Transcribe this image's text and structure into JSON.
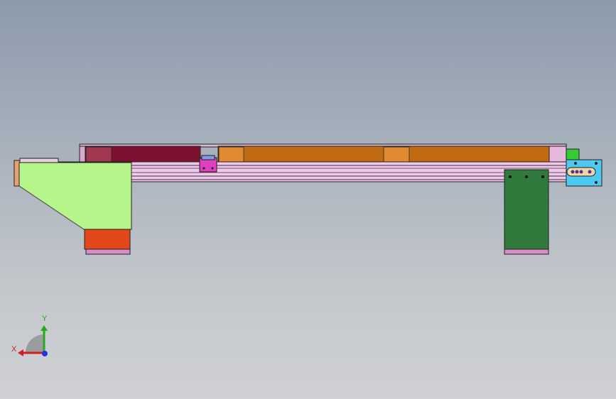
{
  "viewport": {
    "background_top": "#8c9aac",
    "background_bottom": "#cfd1d4"
  },
  "model": {
    "parts": [
      {
        "name": "rail-beam",
        "color": "#f2c8ec"
      },
      {
        "name": "left-hopper",
        "color": "#b5f58c"
      },
      {
        "name": "left-base",
        "color": "#e2481a"
      },
      {
        "name": "right-support",
        "color": "#2f7a3a"
      },
      {
        "name": "dark-red-block",
        "color": "#7d1230"
      },
      {
        "name": "orange-belt",
        "color": "#c06a12"
      },
      {
        "name": "end-bracket",
        "color": "#4fc8f2"
      },
      {
        "name": "motor-box",
        "color": "#33cc33"
      },
      {
        "name": "carriage",
        "color": "#e040c0"
      }
    ]
  },
  "triad": {
    "x_label": "X",
    "y_label": "Y",
    "x_color": "#cc2222",
    "y_color": "#22aa22",
    "z_color": "#2233dd"
  }
}
